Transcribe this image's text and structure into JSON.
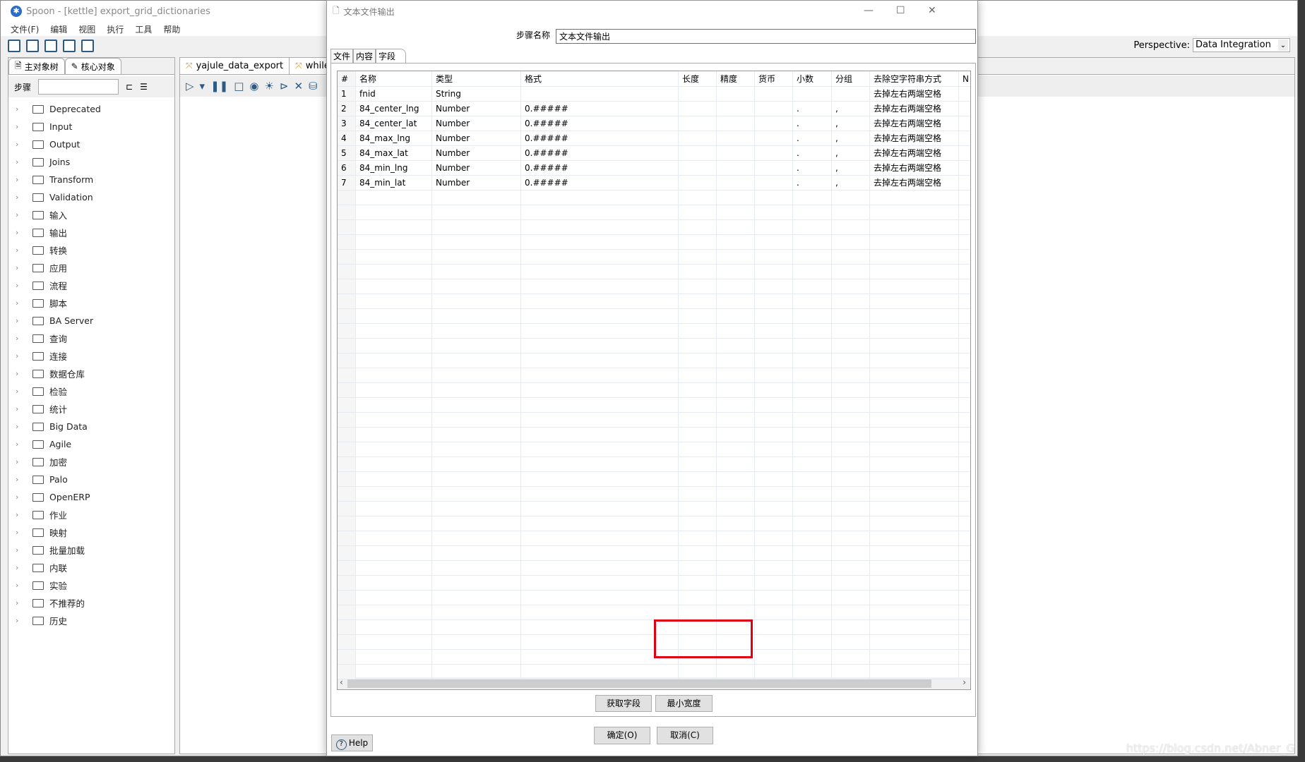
{
  "app": {
    "title": "Spoon - [kettle] export_grid_dictionaries",
    "menu": [
      "文件(F)",
      "编辑",
      "视图",
      "执行",
      "工具",
      "帮助"
    ],
    "perspective_label": "Perspective:",
    "perspective_value": "Data Integration",
    "left_tabs": [
      "主对象树",
      "核心对象"
    ],
    "steps_label": "步骤",
    "steps_search_value": "",
    "tree": [
      "Deprecated",
      "Input",
      "Output",
      "Joins",
      "Transform",
      "Validation",
      "输入",
      "输出",
      "转换",
      "应用",
      "流程",
      "脚本",
      "BA Server",
      "查询",
      "连接",
      "数据仓库",
      "检验",
      "统计",
      "Big Data",
      "Agile",
      "加密",
      "Palo",
      "OpenERP",
      "作业",
      "映射",
      "批量加载",
      "内联",
      "实验",
      "不推荐的",
      "历史"
    ],
    "canvas_tabs": [
      "yajule_data_export",
      "while"
    ],
    "watermark": "https://blog.csdn.net/Abner_G"
  },
  "dialog": {
    "title": "文本文件输出",
    "stepname_label": "步骤名称",
    "stepname_value": "文本文件输出",
    "tabs": [
      "文件",
      "内容",
      "字段"
    ],
    "active_tab": "字段",
    "columns": [
      "#",
      "名称",
      "类型",
      "格式",
      "长度",
      "精度",
      "货币",
      "小数",
      "分组",
      "去除空字符串方式",
      "N"
    ],
    "rows": [
      [
        "1",
        "fnid",
        "String",
        "",
        "",
        "",
        "",
        "",
        "",
        "去掉左右两端空格"
      ],
      [
        "2",
        "84_center_lng",
        "Number",
        "0.#####",
        "",
        "",
        "",
        ".",
        ",",
        "去掉左右两端空格"
      ],
      [
        "3",
        "84_center_lat",
        "Number",
        "0.#####",
        "",
        "",
        "",
        ".",
        ",",
        "去掉左右两端空格"
      ],
      [
        "4",
        "84_max_lng",
        "Number",
        "0.#####",
        "",
        "",
        "",
        ".",
        ",",
        "去掉左右两端空格"
      ],
      [
        "5",
        "84_max_lat",
        "Number",
        "0.#####",
        "",
        "",
        "",
        ".",
        ",",
        "去掉左右两端空格"
      ],
      [
        "6",
        "84_min_lng",
        "Number",
        "0.#####",
        "",
        "",
        "",
        ".",
        ",",
        "去掉左右两端空格"
      ],
      [
        "7",
        "84_min_lat",
        "Number",
        "0.#####",
        "",
        "",
        "",
        ".",
        ",",
        "去掉左右两端空格"
      ]
    ],
    "get_fields": "获取字段",
    "min_width": "最小宽度",
    "ok": "确定(O)",
    "cancel": "取消(C)",
    "help": "Help",
    "highlight_color": "#e00012"
  }
}
